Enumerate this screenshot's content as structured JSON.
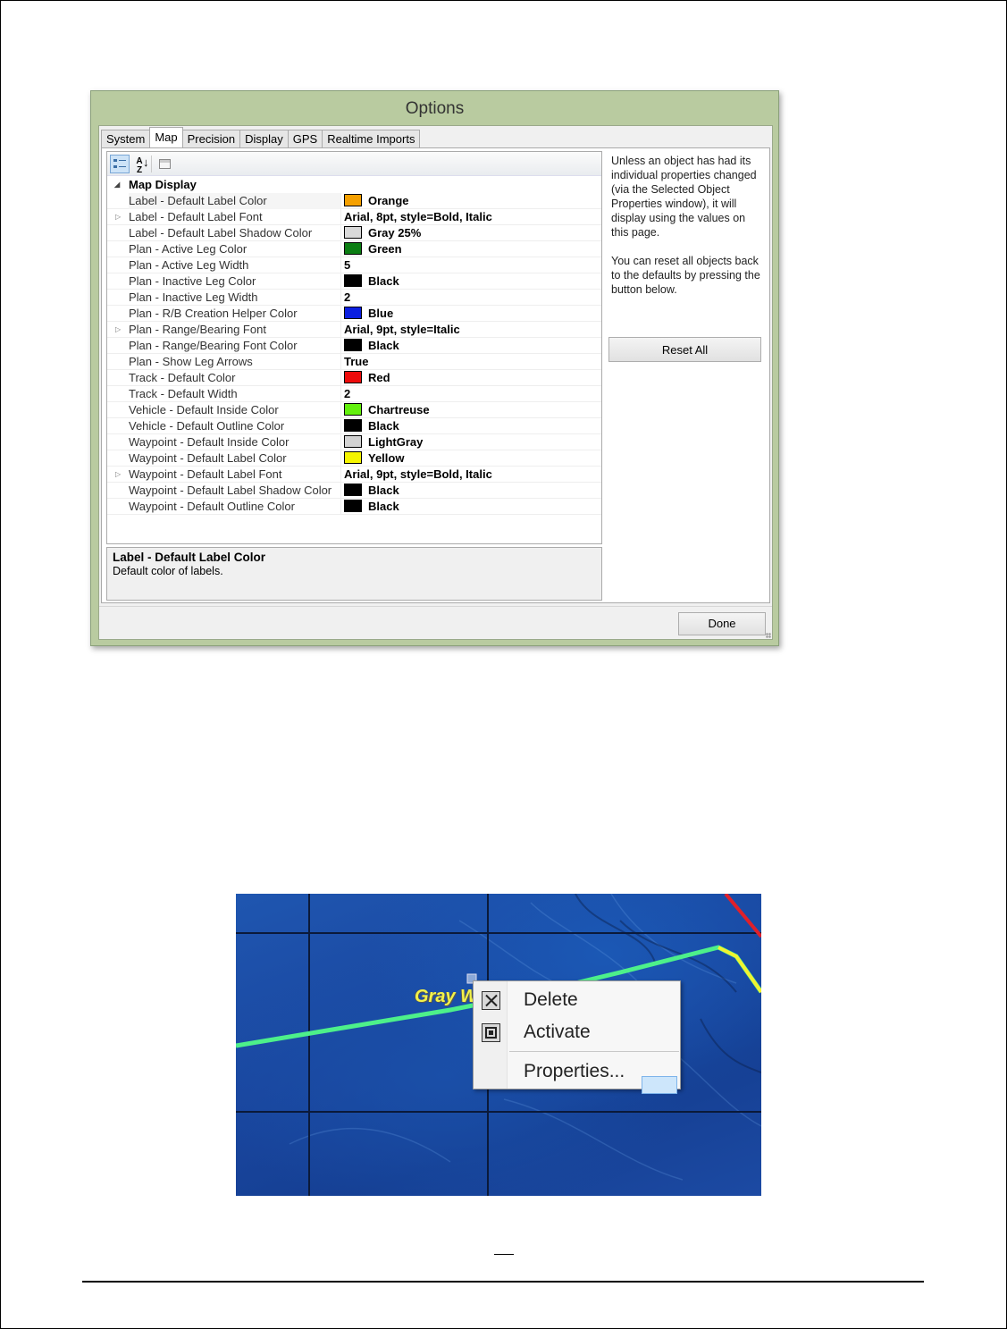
{
  "window": {
    "title": "Options"
  },
  "tabs": [
    "System",
    "Map",
    "Precision",
    "Display",
    "GPS",
    "Realtime Imports"
  ],
  "active_tab": "Map",
  "toolbar": {
    "categorized_icon": "categorized-icon",
    "alphabetical_icon": "sort-az-icon",
    "alphabetical_text": "A Z",
    "pages_icon": "property-pages-icon"
  },
  "category": {
    "label": "Map Display",
    "toggle": "◢"
  },
  "properties": [
    {
      "name": "Label - Default Label Color",
      "value": "Orange",
      "swatch": "#f5a000"
    },
    {
      "name": "Label - Default Label Font",
      "value": "Arial, 8pt, style=Bold, Italic",
      "expandable": true
    },
    {
      "name": "Label - Default Label Shadow Color",
      "value": "Gray 25%",
      "swatch": "#d9d9d9"
    },
    {
      "name": "Plan - Active Leg Color",
      "value": "Green",
      "swatch": "#0a7d12"
    },
    {
      "name": "Plan - Active Leg Width",
      "value": "5"
    },
    {
      "name": "Plan - Inactive Leg Color",
      "value": "Black",
      "swatch": "#000000"
    },
    {
      "name": "Plan - Inactive Leg Width",
      "value": "2"
    },
    {
      "name": "Plan - R/B Creation Helper Color",
      "value": "Blue",
      "swatch": "#0a1ee0"
    },
    {
      "name": "Plan - Range/Bearing Font",
      "value": "Arial, 9pt, style=Italic",
      "expandable": true
    },
    {
      "name": "Plan - Range/Bearing Font Color",
      "value": "Black",
      "swatch": "#000000"
    },
    {
      "name": "Plan - Show Leg Arrows",
      "value": "True"
    },
    {
      "name": "Track - Default Color",
      "value": "Red",
      "swatch": "#ee0b0b"
    },
    {
      "name": "Track - Default Width",
      "value": "2"
    },
    {
      "name": "Vehicle - Default Inside Color",
      "value": "Chartreuse",
      "swatch": "#62f00c"
    },
    {
      "name": "Vehicle - Default Outline Color",
      "value": "Black",
      "swatch": "#000000"
    },
    {
      "name": "Waypoint - Default Inside Color",
      "value": "LightGray",
      "swatch": "#d3d3d3"
    },
    {
      "name": "Waypoint - Default Label Color",
      "value": "Yellow",
      "swatch": "#f5f500"
    },
    {
      "name": "Waypoint - Default Label Font",
      "value": "Arial, 9pt, style=Bold, Italic",
      "expandable": true
    },
    {
      "name": "Waypoint - Default Label Shadow Color",
      "value": "Black",
      "swatch": "#000000"
    },
    {
      "name": "Waypoint - Default Outline Color",
      "value": "Black",
      "swatch": "#000000"
    }
  ],
  "description": {
    "title": "Label - Default Label Color",
    "text": "Default color of labels."
  },
  "side_note": {
    "p1": "Unless an object has had its individual properties changed (via the Selected Object Properties window), it will display using the values on this page.",
    "p2": "You can reset all objects back to the defaults by pressing the button below."
  },
  "buttons": {
    "reset": "Reset All",
    "done": "Done"
  },
  "map": {
    "label_text": "Gray W",
    "line_colors": {
      "route": "#4df08a",
      "yellow": "#f2f230",
      "red": "#e0202a",
      "grid": "#0b1a3a"
    },
    "menu": {
      "delete": "Delete",
      "activate": "Activate",
      "properties": "Properties..."
    }
  },
  "footer": {
    "page_number": ""
  }
}
